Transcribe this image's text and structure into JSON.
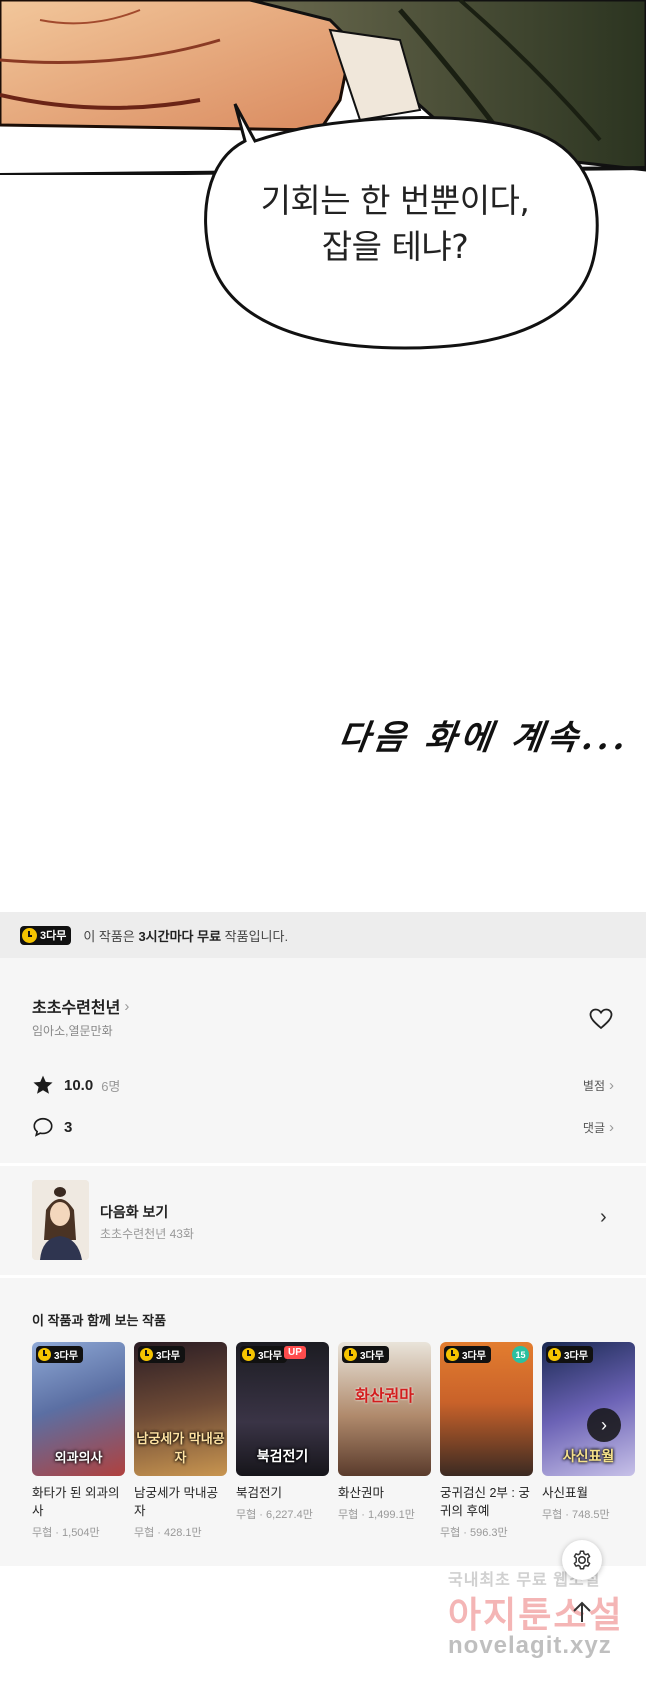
{
  "comic": {
    "speech_line1": "기회는 한 번뿐이다,",
    "speech_line2": "잡을 테냐?",
    "continue": "다음 화에 계속..."
  },
  "free_banner": {
    "badge": "3다무",
    "text_pre": "이 작품은 ",
    "text_bold": "3시간마다 무료",
    "text_post": " 작품입니다."
  },
  "series": {
    "title": "초초수련천년",
    "authors": "임아소,열문만화",
    "rating": "10.0",
    "rating_count": "6명",
    "rating_link": "별점",
    "comment_count": "3",
    "comment_link": "댓글"
  },
  "next_episode": {
    "label": "다음화 보기",
    "sub": "초초수련천년 43화"
  },
  "recommendations": {
    "title": "이 작품과 함께 보는 작품",
    "items": [
      {
        "name": "화타가 된 외과의사",
        "meta": "무협 · 1,504만",
        "badge": "3다무",
        "cover_text": "외과의사"
      },
      {
        "name": "남궁세가 막내공자",
        "meta": "무협 · 428.1만",
        "badge": "3다무",
        "cover_text": "남궁세가 막내공자"
      },
      {
        "name": "북검전기",
        "meta": "무협 · 6,227.4만",
        "badge": "3다무",
        "tag": "UP",
        "cover_text": "북검전기"
      },
      {
        "name": "화산권마",
        "meta": "무협 · 1,499.1만",
        "badge": "3다무",
        "cover_text": "화산권마"
      },
      {
        "name": "궁귀검신 2부 : 궁귀의 후예",
        "meta": "무협 · 596.3만",
        "badge": "3다무",
        "age": "15",
        "cover_text": ""
      },
      {
        "name": "사신표월",
        "meta": "무협 · 748.5만",
        "badge": "3다무",
        "cover_text": "사신표월"
      }
    ]
  },
  "watermark": {
    "line1": "국내최초 무료 웹소설",
    "line2": "아지툰소설",
    "line3": "novelagit.xyz"
  },
  "colors": {
    "free_badge_bg": "#111111",
    "clock_yellow": "#f5c400",
    "up_tag": "#ff4d4d",
    "age_tag": "#2cc0a0",
    "section_bg": "#f6f6f6",
    "banner_bg": "#ededed"
  },
  "icons": [
    "clock-icon",
    "chevron-right-icon",
    "heart-icon",
    "star-icon",
    "comment-icon",
    "settings-gear-icon",
    "arrow-up-icon"
  ]
}
